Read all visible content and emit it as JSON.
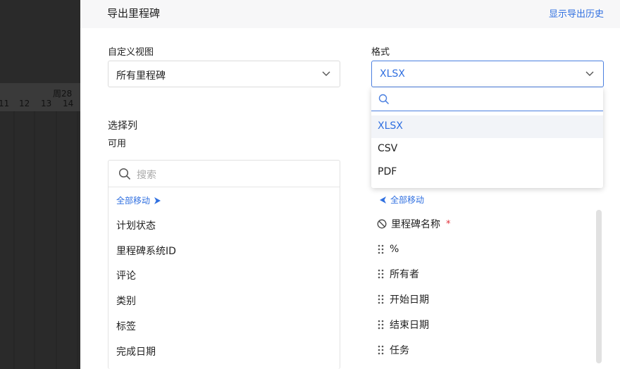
{
  "background": {
    "week_label": "周28",
    "day_labels": [
      "11",
      "12",
      "13",
      "14"
    ]
  },
  "modal": {
    "title": "导出里程碑",
    "history_link": "显示导出历史"
  },
  "custom_view": {
    "label": "自定义视图",
    "value": "所有里程碑"
  },
  "format": {
    "label": "格式",
    "value": "XLSX",
    "options": [
      "XLSX",
      "CSV",
      "PDF"
    ],
    "selected_option": "XLSX"
  },
  "columns": {
    "section_label": "选择列",
    "available_label": "可用",
    "search_placeholder": "搜索",
    "move_all_right": "全部移动",
    "move_all_left": "全部移动",
    "available": [
      "计划状态",
      "里程碑系统ID",
      "评论",
      "类别",
      "标签",
      "完成日期"
    ],
    "selected": [
      {
        "label": "里程碑名称",
        "required_mark": "*"
      },
      {
        "label": "%"
      },
      {
        "label": "所有者"
      },
      {
        "label": "开始日期"
      },
      {
        "label": "结束日期"
      },
      {
        "label": "任务"
      }
    ]
  },
  "colors": {
    "accent": "#2f6fe0",
    "required": "#e0303a"
  }
}
